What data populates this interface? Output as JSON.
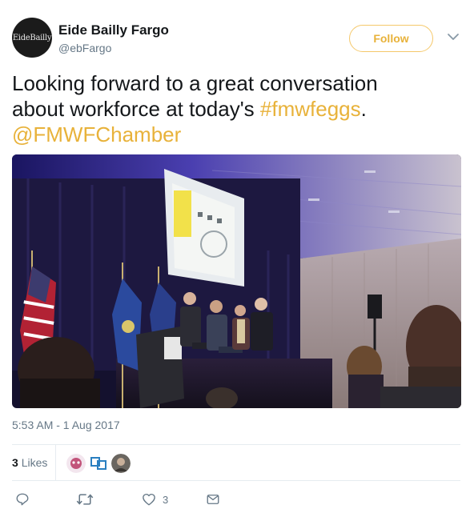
{
  "author": {
    "avatar_text": "EideBailly",
    "name": "Eide Bailly Fargo",
    "handle": "@ebFargo"
  },
  "follow_label": "Follow",
  "tweet": {
    "line1": "Looking forward to a great conversation",
    "line2_prefix": "about workforce at today's ",
    "hashtag": "#fmwfeggs",
    "line2_suffix": ".",
    "mention": "@FMWFChamber"
  },
  "timestamp": "5:53 AM - 1 Aug 2017",
  "likes": {
    "count": "3",
    "label": "Likes"
  },
  "actions": {
    "like_count": "3"
  },
  "icons": {
    "chevron": "chevron-down-icon",
    "reply": "reply-icon",
    "retweet": "retweet-icon",
    "like": "heart-icon",
    "dm": "envelope-icon"
  },
  "colors": {
    "accent": "#e8b23a",
    "secondary_text": "#657786"
  }
}
